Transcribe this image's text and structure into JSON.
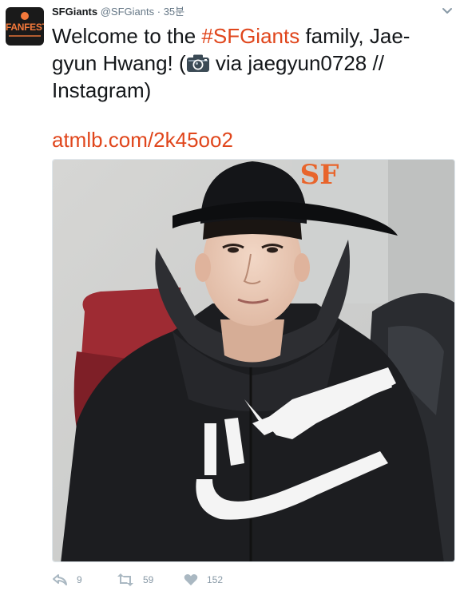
{
  "tweet": {
    "account_name": "SFGiants",
    "handle": "@SFGiants",
    "separator": "·",
    "time": "35분",
    "avatar": {
      "text": "FANFEST",
      "icon": "fanfest-logo"
    },
    "text_before": "Welcome to the ",
    "hashtag": "#SFGiants",
    "text_after_hashtag": " family, Jae-gyun Hwang! (",
    "camera_icon": "camera-icon",
    "text_after_icon": " via jaegyun0728 // Instagram)",
    "link": "atmlb.com/2k45oo2",
    "photo": {
      "icon": "photo-player-in-giants-cap"
    }
  },
  "actions": {
    "reply_count": "9",
    "retweet_count": "59",
    "like_count": "152"
  },
  "colors": {
    "accent": "#e0461c",
    "text": "#14171a",
    "muted": "#657786",
    "action_gray": "#8899a6"
  }
}
